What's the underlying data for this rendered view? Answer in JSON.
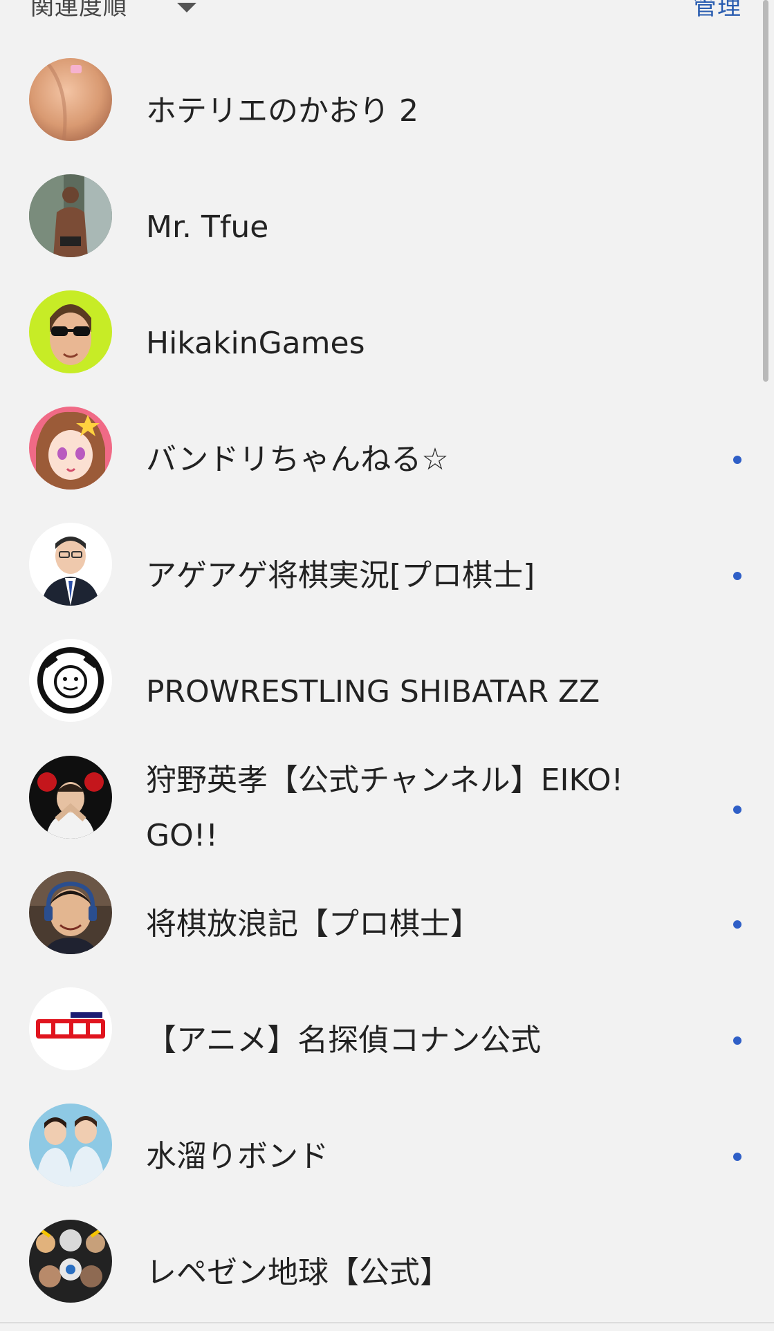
{
  "header": {
    "sort_label": "関連度順",
    "manage_label": "管理"
  },
  "subscriptions": [
    {
      "name": "ホテリエのかおり 2",
      "new_indicator": false,
      "avatar_icon": "channel-avatar-skin-photo"
    },
    {
      "name": "Mr. Tfue",
      "new_indicator": false,
      "avatar_icon": "channel-avatar-man-waterfall"
    },
    {
      "name": "HikakinGames",
      "new_indicator": false,
      "avatar_icon": "channel-avatar-sunglasses-green"
    },
    {
      "name": "バンドリちゃんねる☆",
      "new_indicator": true,
      "avatar_icon": "channel-avatar-anime-girl"
    },
    {
      "name": "アゲアゲ将棋実況[プロ棋士]",
      "new_indicator": true,
      "avatar_icon": "channel-avatar-man-suit"
    },
    {
      "name": "PROWRESTLING SHIBATAR ZZ",
      "new_indicator": false,
      "avatar_icon": "channel-avatar-wrestling-logo"
    },
    {
      "name": "狩野英孝【公式チャンネル】EIKO! GO!!",
      "new_indicator": true,
      "avatar_icon": "channel-avatar-roses-man"
    },
    {
      "name": "将棋放浪記【プロ棋士】",
      "new_indicator": true,
      "avatar_icon": "channel-avatar-man-headset"
    },
    {
      "name": "【アニメ】名探偵コナン公式",
      "new_indicator": true,
      "avatar_icon": "channel-avatar-conan-logo"
    },
    {
      "name": "水溜りボンド",
      "new_indicator": true,
      "avatar_icon": "channel-avatar-two-men"
    },
    {
      "name": "レペゼン地球【公式】",
      "new_indicator": false,
      "avatar_icon": "channel-avatar-group-photo"
    }
  ],
  "colors": {
    "background": "#f2f2f2",
    "accent": "#2a5db0",
    "indicator": "#2f5fc7"
  }
}
